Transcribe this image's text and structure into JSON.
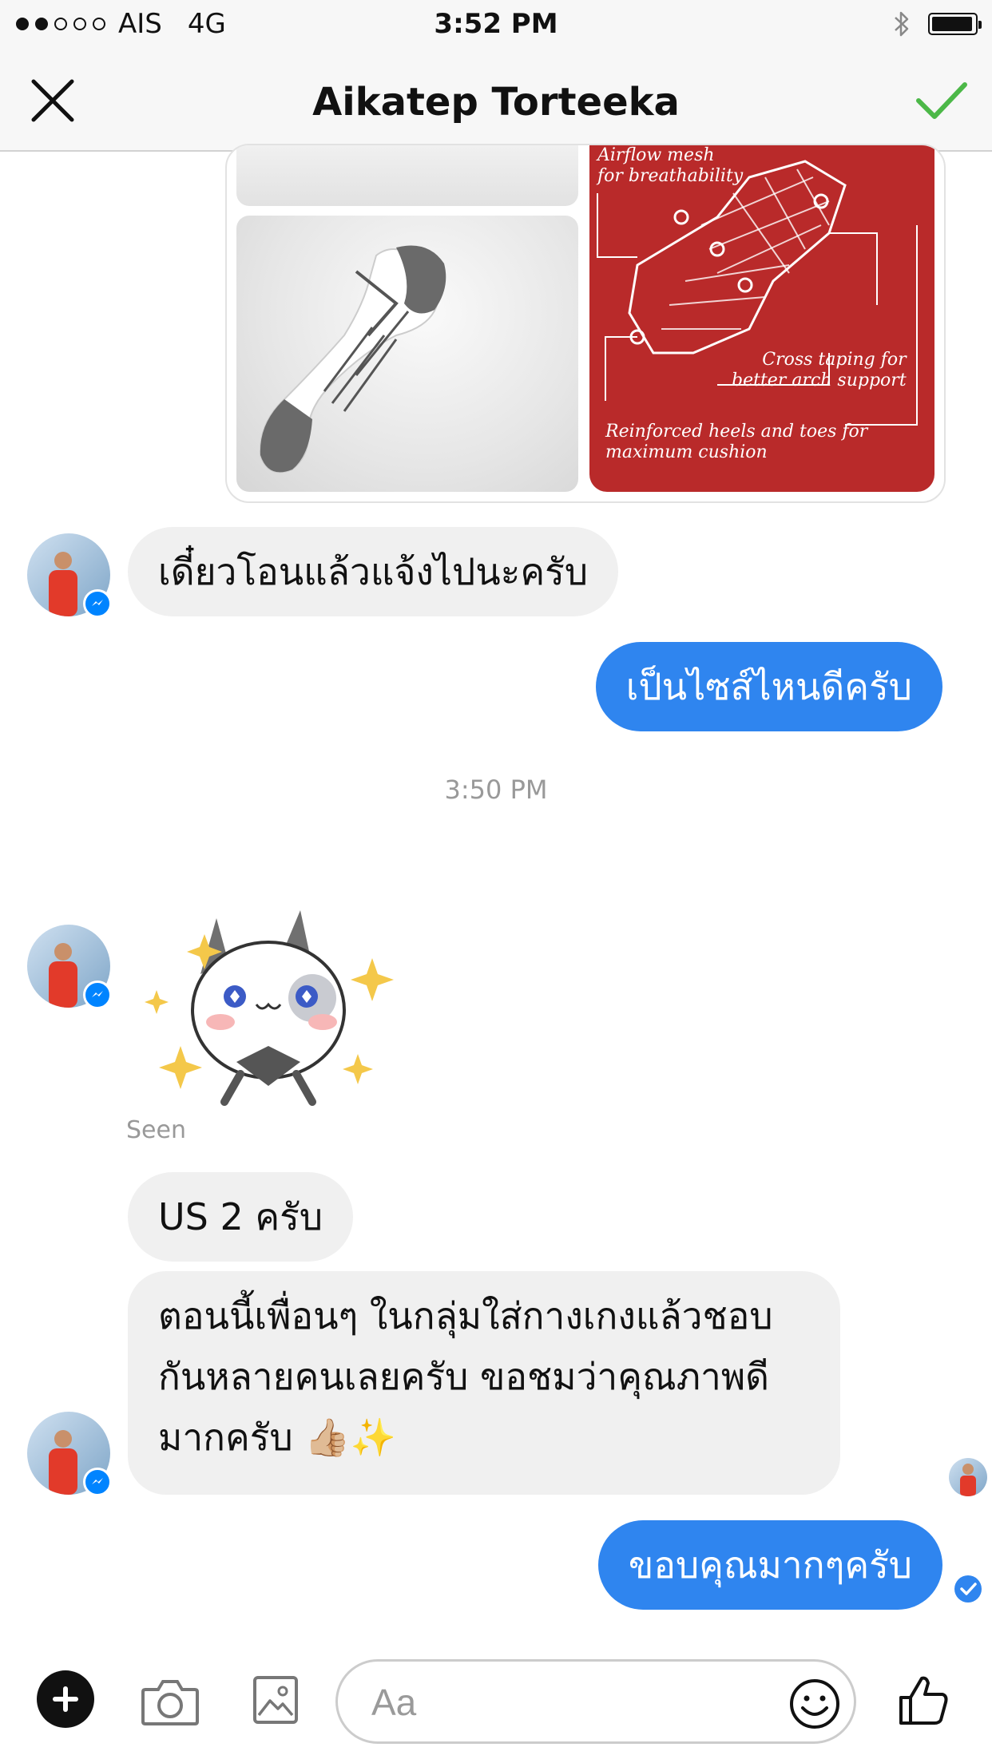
{
  "status_bar": {
    "carrier": "AIS",
    "network": "4G",
    "time": "3:52 PM",
    "signal_strength": 2,
    "icons": [
      "bluetooth-icon",
      "battery-icon"
    ]
  },
  "header": {
    "title": "Aikatep Torteeka",
    "close_icon": "close-icon",
    "done_icon": "checkmark-icon",
    "accent_color": "#4cb848"
  },
  "product_images": {
    "diagram_text": {
      "top": "Airflow mesh\nfor breathability",
      "middle": "Cross taping for\nbetter arch support",
      "bottom": "Reinforced heels and toes for\nmaximum cushion"
    }
  },
  "messages": [
    {
      "id": "m1",
      "direction": "incoming",
      "text": "เดี๋ยวโอนแล้วแจ้งไปนะครับ"
    },
    {
      "id": "m2",
      "direction": "outgoing",
      "text": "เป็นไซส์ไหนดีครับ"
    },
    {
      "id": "m4",
      "direction": "incoming",
      "text": "US 2 ครับ"
    },
    {
      "id": "m5",
      "direction": "incoming",
      "text": "ตอนนี้เพื่อนๆ ในกลุ่มใส่กางเกงแล้วชอบกันหลายคนเลยครับ ขอชมว่าคุณภาพดีมากครับ 👍🏼✨",
      "lines": [
        "ตอนนี้เพื่อนๆ ในกลุ่มใส่กางเกงแล้วชอบ",
        "กันหลายคนเลยครับ ขอชมว่าคุณภาพดี",
        "มากครับ 👍🏼✨"
      ]
    },
    {
      "id": "m6",
      "direction": "outgoing",
      "text": "ขอบคุณมากๆครับ"
    }
  ],
  "timestamp": "3:50 PM",
  "seen_label": "Seen",
  "composer": {
    "placeholder": "Aa",
    "icons": [
      "plus-icon",
      "camera-icon",
      "image-icon",
      "emoji-icon",
      "thumbs-up-icon"
    ]
  },
  "colors": {
    "outgoing_bubble": "#2f85ef",
    "incoming_bubble": "#f0f0f0",
    "messenger_blue": "#0084ff"
  }
}
